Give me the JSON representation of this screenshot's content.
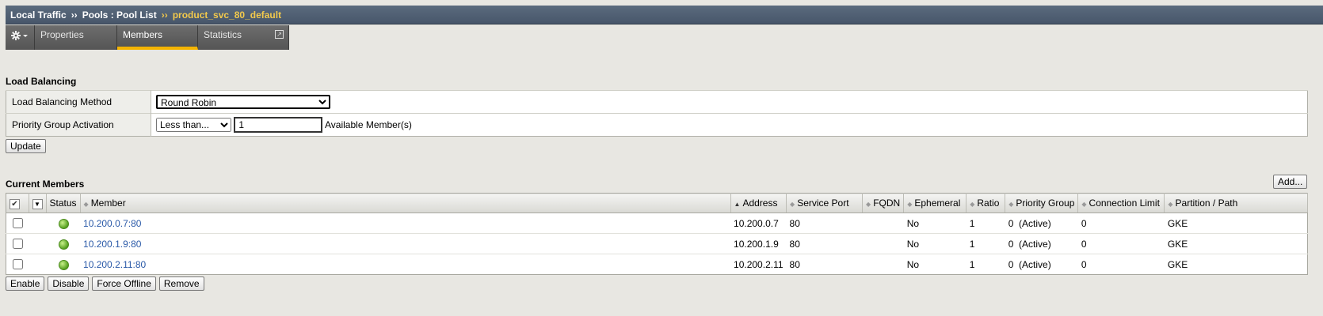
{
  "breadcrumb": {
    "part1": "Local Traffic",
    "sep1": "››",
    "part2": "Pools : Pool List",
    "sep2": "››",
    "current": "product_svc_80_default"
  },
  "tabs": [
    {
      "label": "Properties"
    },
    {
      "label": "Members"
    },
    {
      "label": "Statistics"
    }
  ],
  "load_balancing": {
    "title": "Load Balancing",
    "method_label": "Load Balancing Method",
    "method_value": "Round Robin",
    "priority_label": "Priority Group Activation",
    "priority_value": "Less than...",
    "priority_count": "1",
    "priority_suffix": "Available Member(s)",
    "update_button": "Update"
  },
  "members": {
    "title": "Current Members",
    "add_button": "Add...",
    "columns": [
      "Status",
      "Member",
      "Address",
      "Service Port",
      "FQDN",
      "Ephemeral",
      "Ratio",
      "Priority Group",
      "Connection Limit",
      "Partition / Path"
    ],
    "rows": [
      {
        "member": "10.200.0.7:80",
        "address": "10.200.0.7",
        "port": "80",
        "fqdn": "",
        "ephemeral": "No",
        "ratio": "1",
        "priority": "0  (Active)",
        "conn_limit": "0",
        "partition": "GKE"
      },
      {
        "member": "10.200.1.9:80",
        "address": "10.200.1.9",
        "port": "80",
        "fqdn": "",
        "ephemeral": "No",
        "ratio": "1",
        "priority": "0  (Active)",
        "conn_limit": "0",
        "partition": "GKE"
      },
      {
        "member": "10.200.2.11:80",
        "address": "10.200.2.11",
        "port": "80",
        "fqdn": "",
        "ephemeral": "No",
        "ratio": "1",
        "priority": "0  (Active)",
        "conn_limit": "0",
        "partition": "GKE"
      }
    ]
  },
  "actions": {
    "enable": "Enable",
    "disable": "Disable",
    "force_offline": "Force Offline",
    "remove": "Remove"
  }
}
